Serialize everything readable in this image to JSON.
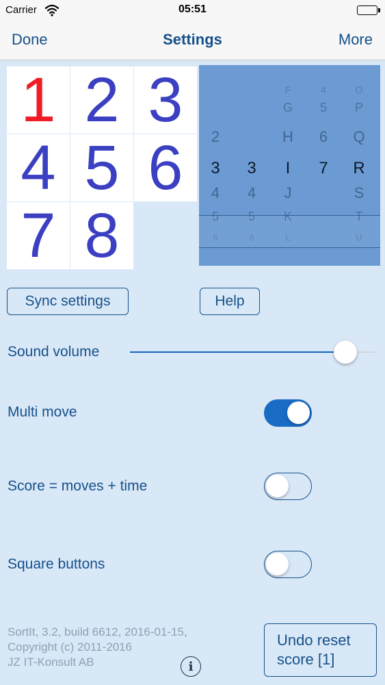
{
  "status_bar": {
    "carrier": "Carrier",
    "time": "05:51"
  },
  "nav": {
    "done": "Done",
    "title": "Settings",
    "more": "More"
  },
  "tiles": [
    "1",
    "2",
    "3",
    "4",
    "5",
    "6",
    "7",
    "8"
  ],
  "picker": {
    "columns": [
      {
        "cells": [
          "",
          "",
          "2",
          "3",
          "4",
          "5",
          "6"
        ]
      },
      {
        "cells": [
          "",
          "",
          "",
          "3",
          "4",
          "5",
          "6"
        ]
      },
      {
        "cells": [
          "F",
          "G",
          "H",
          "I",
          "J",
          "K",
          "L"
        ]
      },
      {
        "cells": [
          "4",
          "5",
          "6",
          "7",
          "",
          "",
          ""
        ]
      },
      {
        "cells": [
          "O",
          "P",
          "Q",
          "R",
          "S",
          "T",
          "U"
        ]
      }
    ]
  },
  "buttons": {
    "sync": "Sync settings",
    "help": "Help"
  },
  "settings": {
    "sound_volume": {
      "label": "Sound volume",
      "value": 0.88
    },
    "multi_move": {
      "label": "Multi move",
      "on": true
    },
    "score_mode": {
      "label": "Score = moves + time",
      "on": false
    },
    "square_buttons": {
      "label": "Square buttons",
      "on": false
    }
  },
  "footer": {
    "line1": "SortIt, 3.2, build 6612, 2016-01-15,",
    "line2": "Copyright (c) 2011-2016",
    "line3": "JZ IT-Konsult AB",
    "info_glyph": "i"
  },
  "undo": {
    "line1": "Undo reset",
    "line2": "score [1]"
  },
  "colors": {
    "accent": "#15508a",
    "toggle_on": "#1a6bc4",
    "tile_text": "#3b3fc2",
    "tile_first": "#ef1c24",
    "background": "#d9e8f7"
  },
  "icons": [
    "wifi-icon",
    "battery-icon",
    "info-icon"
  ]
}
